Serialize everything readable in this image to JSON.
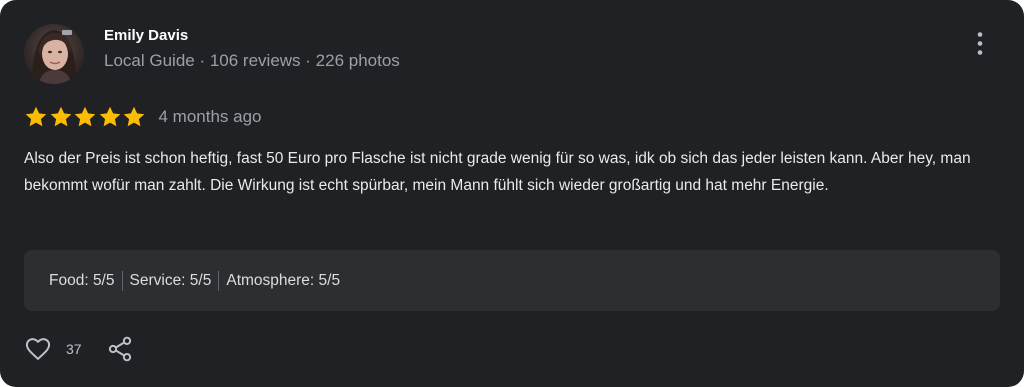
{
  "review": {
    "author": {
      "name": "Emily Davis",
      "meta": "Local Guide · 106 reviews · 226 photos"
    },
    "rating": 5,
    "max_rating": 5,
    "date": "4 months ago",
    "text": "Also der Preis ist schon heftig, fast 50 Euro pro Flasche ist nicht grade wenig für so was, idk ob sich das jeder leisten kann. Aber hey, man bekommt wofür man zahlt. Die Wirkung ist echt spürbar, mein Mann fühlt sich wieder großartig und hat mehr Energie.",
    "attributes": [
      {
        "label": "Food: 5/5"
      },
      {
        "label": "Service: 5/5"
      },
      {
        "label": "Atmosphere: 5/5"
      }
    ],
    "likes": "37"
  },
  "icons": {
    "star": "star-icon",
    "more": "more-vert-icon",
    "like": "heart-outline-icon",
    "share": "share-icon"
  },
  "colors": {
    "card_background": "#202124",
    "attributes_background": "#2d2e31",
    "star": "#fbbc04",
    "primary_text": "#e8eaed",
    "secondary_text": "#9aa0a6"
  }
}
